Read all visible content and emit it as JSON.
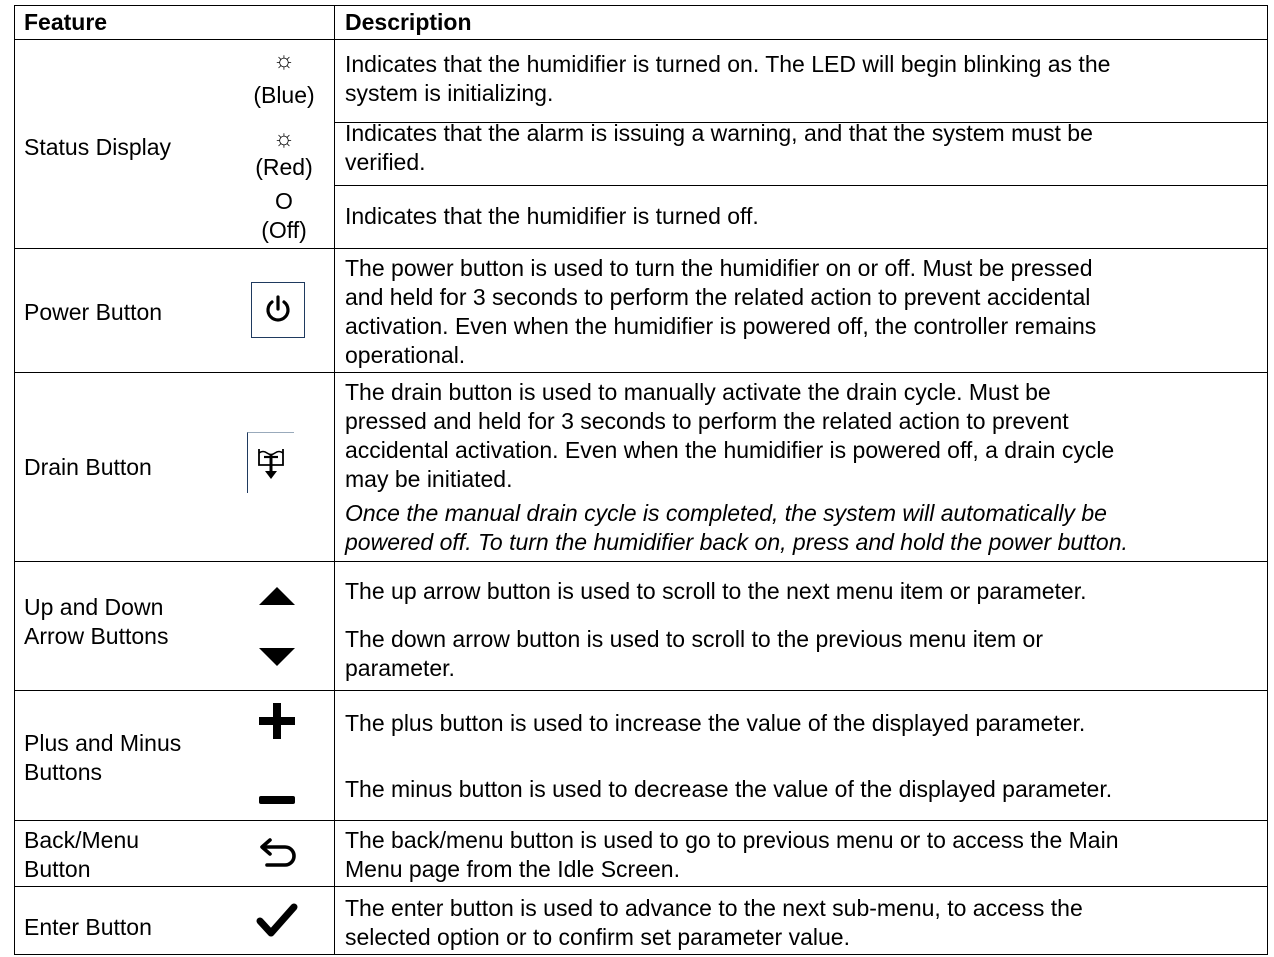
{
  "header": {
    "feature": "Feature",
    "description": "Description"
  },
  "status_display": {
    "label": "Status Display",
    "states": [
      {
        "symbol": "☼",
        "color_name": "(Blue)",
        "description": [
          "Indicates that the humidifier is turned on. The LED will begin blinking as the",
          "system is initializing."
        ]
      },
      {
        "symbol": "☼",
        "color_name": "(Red)",
        "description": [
          "Indicates that the alarm is issuing a warning, and that the system must be",
          "verified."
        ]
      },
      {
        "symbol": "O",
        "color_name": "(Off)",
        "description": [
          "Indicates that the humidifier is turned off."
        ]
      }
    ]
  },
  "power": {
    "label": "Power Button",
    "icon": "power-icon",
    "description": [
      "The power button is used to turn the humidifier on or off. Must be pressed",
      "and held for 3 seconds to perform the related action to prevent accidental",
      "activation. Even when the humidifier is powered off, the controller remains",
      "operational."
    ]
  },
  "drain": {
    "label": "Drain Button",
    "icon": "drain-icon",
    "description": [
      "The drain button is used to manually activate the drain cycle. Must be",
      "pressed and held for 3 seconds to perform the related action to prevent",
      "accidental activation. Even when the humidifier is powered off, a drain cycle",
      "may be initiated."
    ],
    "note": [
      "Once the manual drain cycle is completed, the system will automatically be",
      "powered off. To turn the humidifier back on, press and hold the power button."
    ]
  },
  "arrows": {
    "label": [
      "Up and Down",
      "Arrow Buttons"
    ],
    "up_description": "The up arrow button is used to scroll to the next menu item or parameter.",
    "down_description": [
      "The down arrow button is used to scroll to the previous menu item or",
      "parameter."
    ]
  },
  "plusminus": {
    "label": [
      "Plus and Minus",
      "Buttons"
    ],
    "plus_description": "The plus button is used to increase the value of the displayed parameter.",
    "minus_description": "The minus button is used to decrease the value of the displayed parameter."
  },
  "back": {
    "label": [
      "Back/Menu",
      "Button"
    ],
    "description": [
      "The back/menu button is used to go to previous menu or to access the Main",
      "Menu page from the Idle Screen."
    ]
  },
  "enter": {
    "label": "Enter Button",
    "description": [
      "The enter button is used to advance to the next sub-menu, to access the",
      "selected option or to confirm set parameter value."
    ]
  },
  "colors": {
    "text": "#000000",
    "border": "#000000",
    "icon_box_border": "#1f3a5f"
  }
}
